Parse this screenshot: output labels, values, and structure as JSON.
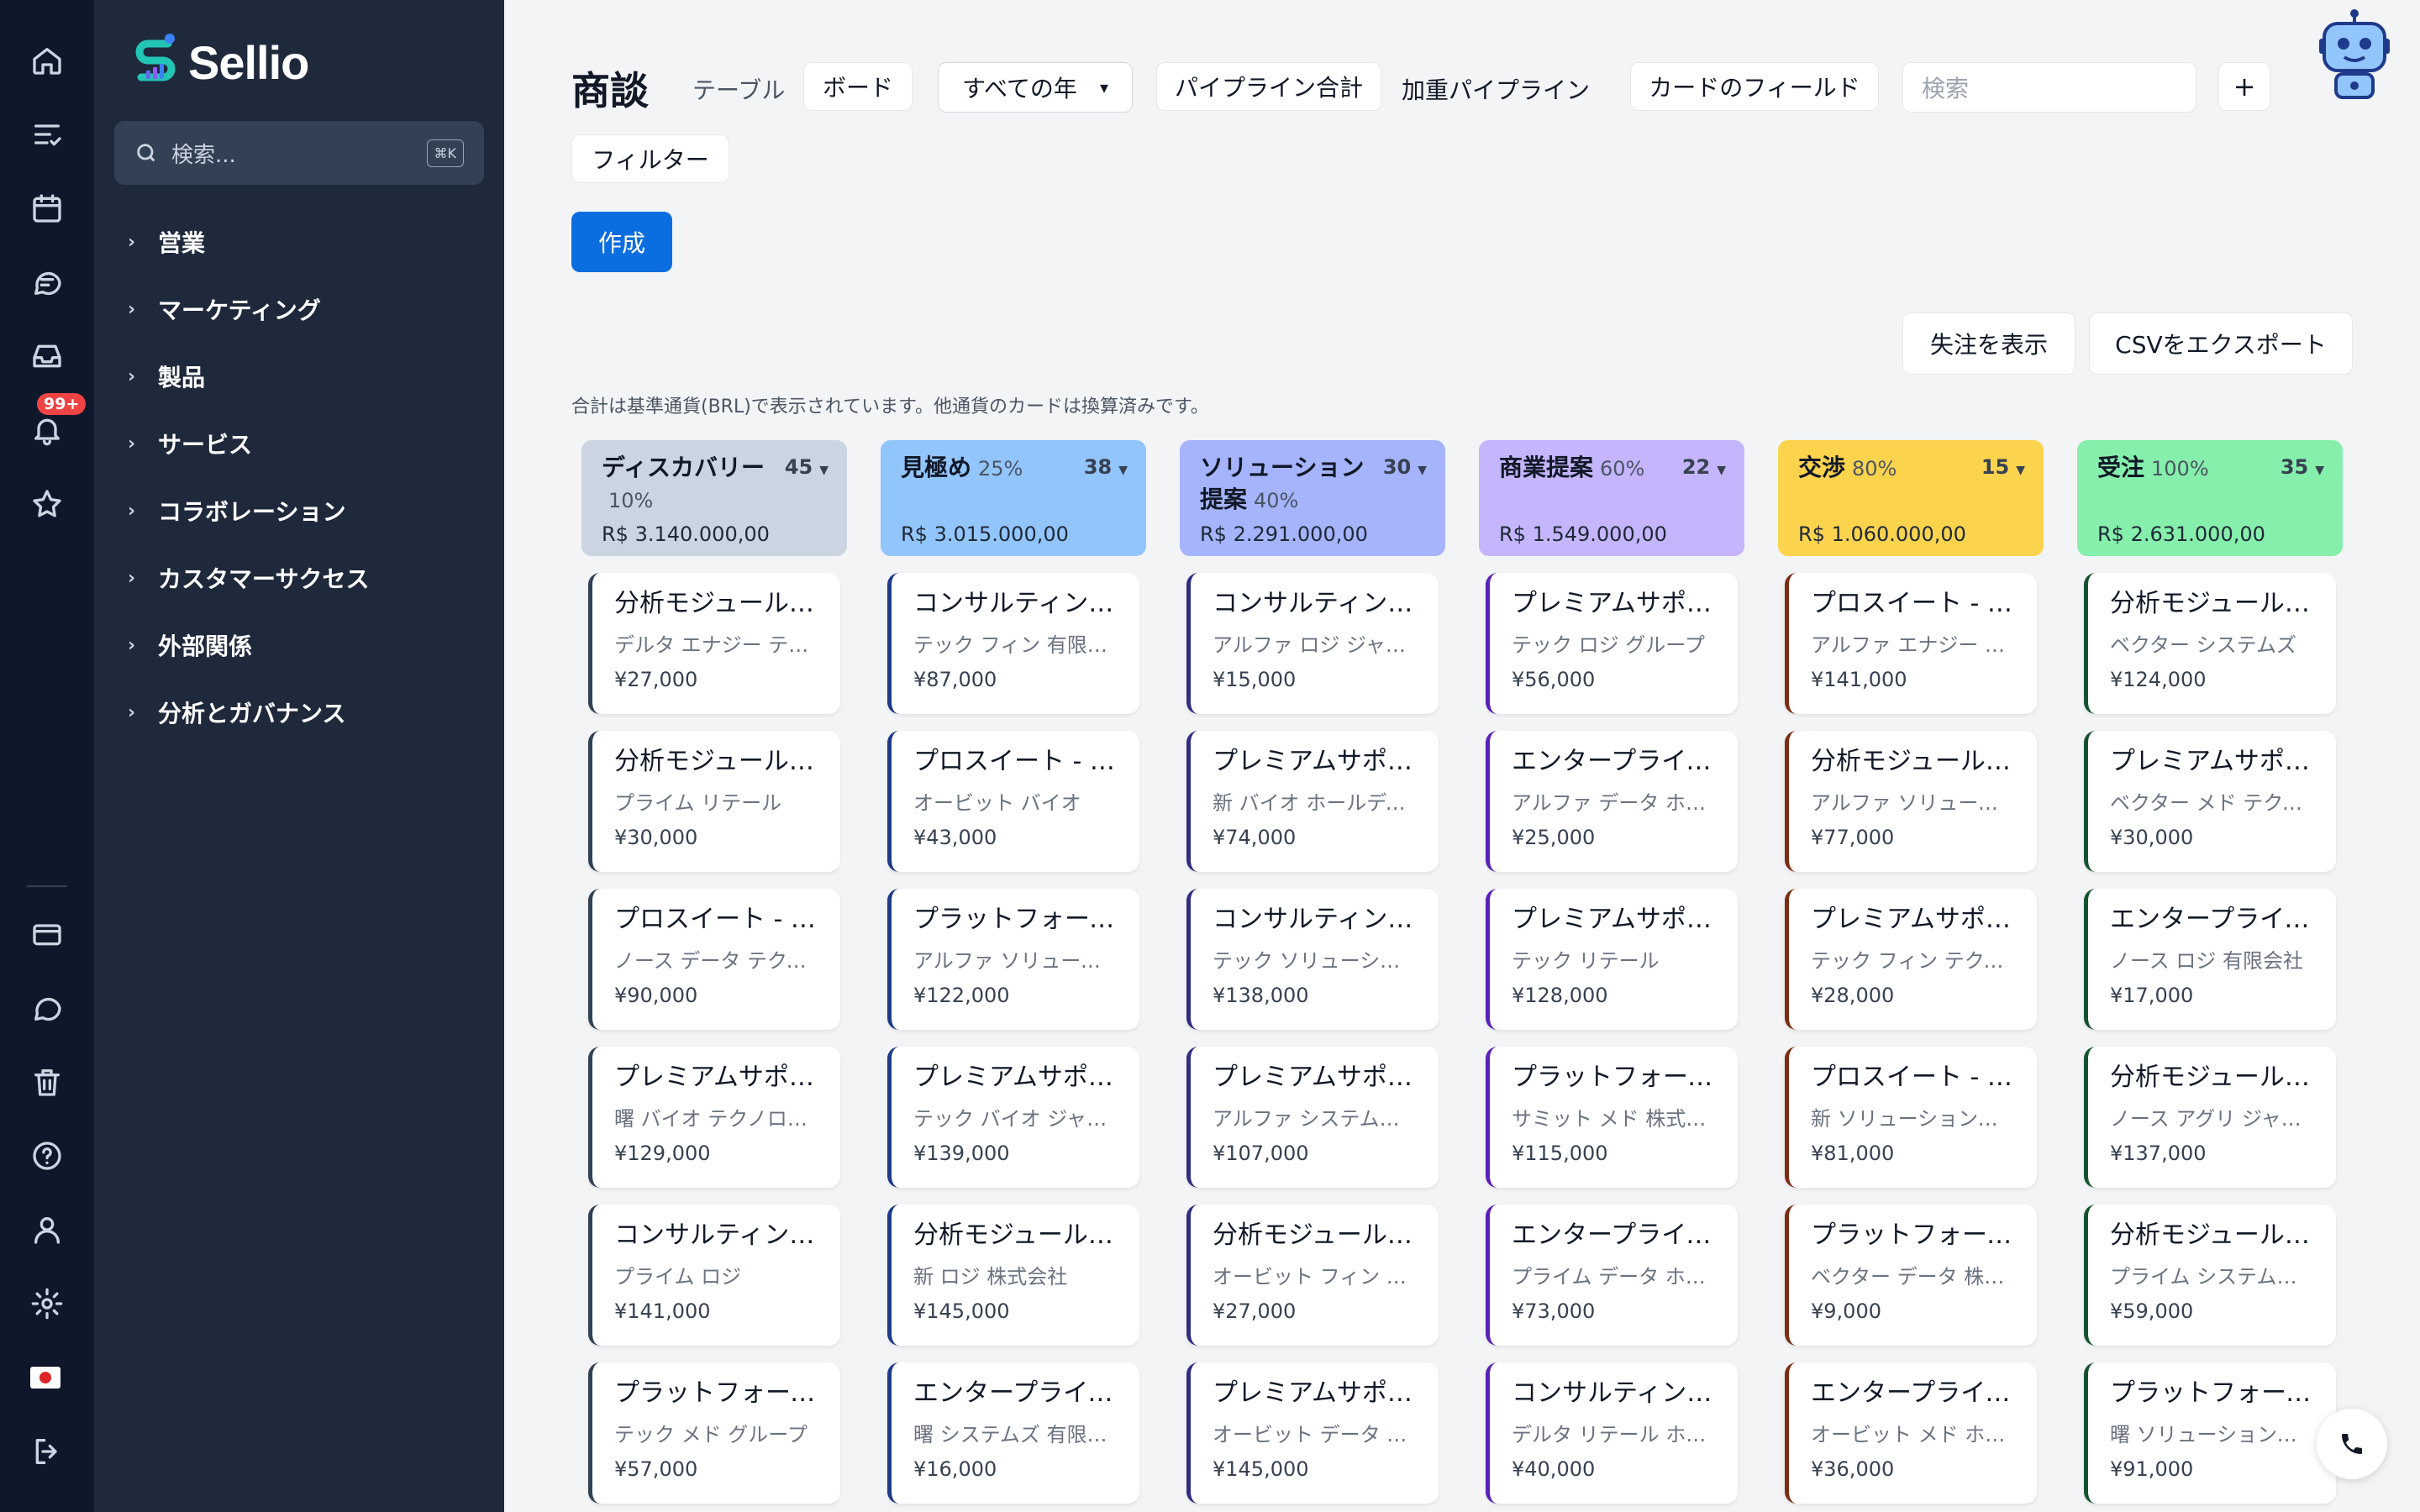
{
  "rail": {
    "badge": "99+",
    "icons": [
      "home-icon",
      "tasks-icon",
      "calendar-icon",
      "chat-icon",
      "inbox-icon",
      "bell-icon",
      "star-icon",
      "card-icon",
      "message-icon",
      "trash-icon",
      "help-icon",
      "user-icon",
      "gear-icon",
      "flag-icon",
      "logout-icon"
    ]
  },
  "sidebar": {
    "brand": "Sellio",
    "search_placeholder": "検索...",
    "search_shortcut": "⌘K",
    "items": [
      "営業",
      "マーケティング",
      "製品",
      "サービス",
      "コラボレーション",
      "カスタマーサクセス",
      "外部関係",
      "分析とガバナンス"
    ]
  },
  "header": {
    "title": "商談",
    "view_table": "テーブル",
    "view_board": "ボード",
    "year_select": "すべての年",
    "pipeline_total": "パイプライン合計",
    "weighted_pipeline": "加重パイプライン",
    "card_fields": "カードのフィールド",
    "search_placeholder": "検索",
    "add": "+",
    "filter": "フィルター",
    "create": "作成",
    "show_won": "失注を表示",
    "export_csv": "CSVをエクスポート",
    "note": "合計は基準通貨(BRL)で表示されています。他通貨のカードは換算済みです。"
  },
  "colors": {
    "accent": "#0b6ee0",
    "stage_discovery": "#cbd5e1",
    "stage_qualify": "#93c5fd",
    "stage_solution": "#a5b4fc",
    "stage_proposal": "#c4b5fd",
    "stage_negotiation": "#fcd34d",
    "stage_won": "#86efac"
  },
  "columns": [
    {
      "name": "ディスカバリー",
      "pct": "10%",
      "count": "45",
      "total": "R$ 3.140.000,00",
      "color": "#cbd5e1",
      "border": "#334155",
      "cards": [
        {
          "title": "分析モジュール - …",
          "company": "デルタ エナジー テク…",
          "amount": "¥27,000"
        },
        {
          "title": "分析モジュール - …",
          "company": "プライム リテール",
          "amount": "¥30,000"
        },
        {
          "title": "プロスイート - ノ…",
          "company": "ノース データ テクノ…",
          "amount": "¥90,000"
        },
        {
          "title": "プレミアムサポー…",
          "company": "曙 バイオ テクノロジ…",
          "amount": "¥129,000"
        },
        {
          "title": "コンサルティング…",
          "company": "プライム ロジ",
          "amount": "¥141,000"
        },
        {
          "title": "プラットフォーム…",
          "company": "テック メド グループ",
          "amount": "¥57,000"
        }
      ]
    },
    {
      "name": "見極め",
      "pct": "25%",
      "count": "38",
      "total": "R$ 3.015.000,00",
      "color": "#93c5fd",
      "border": "#1e3a8a",
      "cards": [
        {
          "title": "コンサルティング…",
          "company": "テック フィン 有限会…",
          "amount": "¥87,000"
        },
        {
          "title": "プロスイート - オ…",
          "company": "オービット バイオ",
          "amount": "¥43,000"
        },
        {
          "title": "プラットフォーム…",
          "company": "アルファ ソリューシ…",
          "amount": "¥122,000"
        },
        {
          "title": "プレミアムサポー…",
          "company": "テック バイオ ジャパ…",
          "amount": "¥139,000"
        },
        {
          "title": "分析モジュール - …",
          "company": "新 ロジ 株式会社",
          "amount": "¥145,000"
        },
        {
          "title": "エンタープライズ…",
          "company": "曙 システムズ 有限会…",
          "amount": "¥16,000"
        }
      ]
    },
    {
      "name": "ソリューション提案",
      "pct": "40%",
      "count": "30",
      "total": "R$ 2.291.000,00",
      "color": "#a5b4fc",
      "border": "#312e81",
      "cards": [
        {
          "title": "コンサルティング…",
          "company": "アルファ ロジ ジャパ…",
          "amount": "¥15,000"
        },
        {
          "title": "プレミアムサポー…",
          "company": "新 バイオ ホールディ…",
          "amount": "¥74,000"
        },
        {
          "title": "コンサルティング…",
          "company": "テック ソリューショ…",
          "amount": "¥138,000"
        },
        {
          "title": "プレミアムサポー…",
          "company": "アルファ システムズ …",
          "amount": "¥107,000"
        },
        {
          "title": "分析モジュール - …",
          "company": "オービット フィン グ…",
          "amount": "¥27,000"
        },
        {
          "title": "プレミアムサポー…",
          "company": "オービット データ ジ…",
          "amount": "¥145,000"
        }
      ]
    },
    {
      "name": "商業提案",
      "pct": "60%",
      "count": "22",
      "total": "R$ 1.549.000,00",
      "color": "#c4b5fd",
      "border": "#5b21b6",
      "cards": [
        {
          "title": "プレミアムサポー…",
          "company": "テック ロジ グループ",
          "amount": "¥56,000"
        },
        {
          "title": "エンタープライズ…",
          "company": "アルファ データ ホー…",
          "amount": "¥25,000"
        },
        {
          "title": "プレミアムサポー…",
          "company": "テック リテール",
          "amount": "¥128,000"
        },
        {
          "title": "プラットフォーム…",
          "company": "サミット メド 株式…",
          "amount": "¥115,000"
        },
        {
          "title": "エンタープライズ…",
          "company": "プライム データ ホー…",
          "amount": "¥73,000"
        },
        {
          "title": "コンサルティング…",
          "company": "デルタ リテール ホー…",
          "amount": "¥40,000"
        }
      ]
    },
    {
      "name": "交渉",
      "pct": "80%",
      "count": "15",
      "total": "R$ 1.060.000,00",
      "color": "#fcd34d",
      "border": "#7c2d12",
      "cards": [
        {
          "title": "プロスイート - ア…",
          "company": "アルファ エナジー ジ…",
          "amount": "¥141,000"
        },
        {
          "title": "分析モジュール - …",
          "company": "アルファ ソリューシ…",
          "amount": "¥77,000"
        },
        {
          "title": "プレミアムサポー…",
          "company": "テック フィン テクノ…",
          "amount": "¥28,000"
        },
        {
          "title": "プロスイート - 新…",
          "company": "新 ソリューションズ …",
          "amount": "¥81,000"
        },
        {
          "title": "プラットフォーム…",
          "company": "ベクター データ 株…",
          "amount": "¥9,000"
        },
        {
          "title": "エンタープライズ…",
          "company": "オービット メド ホー…",
          "amount": "¥36,000"
        }
      ]
    },
    {
      "name": "受注",
      "pct": "100%",
      "count": "35",
      "total": "R$ 2.631.000,00",
      "color": "#86efac",
      "border": "#14532d",
      "cards": [
        {
          "title": "分析モジュール - …",
          "company": "ベクター システムズ",
          "amount": "¥124,000"
        },
        {
          "title": "プレミアムサポー…",
          "company": "ベクター メド テクノ…",
          "amount": "¥30,000"
        },
        {
          "title": "エンタープライズ…",
          "company": "ノース ロジ 有限会社",
          "amount": "¥17,000"
        },
        {
          "title": "分析モジュール - …",
          "company": "ノース アグリ ジャパン",
          "amount": "¥137,000"
        },
        {
          "title": "分析モジュール - …",
          "company": "プライム システムズ …",
          "amount": "¥59,000"
        },
        {
          "title": "プラットフォーム…",
          "company": "曙 ソリューションズ …",
          "amount": "¥91,000"
        }
      ]
    }
  ]
}
